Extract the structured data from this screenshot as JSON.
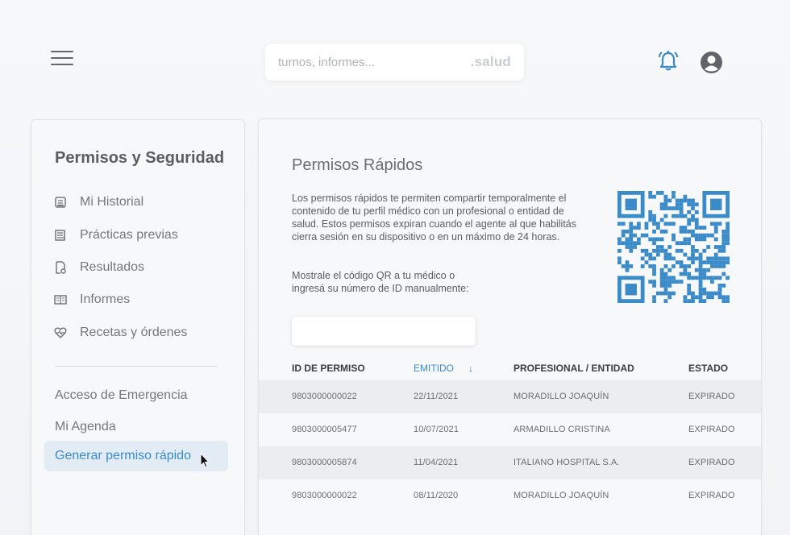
{
  "header": {
    "search_placeholder": "turnos, informes...",
    "brand": ".salud",
    "accent_color": "#3a8bc8",
    "icons": [
      "menu-icon",
      "bell-icon",
      "user-icon"
    ]
  },
  "sidebar": {
    "title": "Permisos y Seguridad",
    "items": [
      {
        "label": "Mi Historial",
        "icon": "history-icon"
      },
      {
        "label": "Prácticas previas",
        "icon": "clipboard-icon"
      },
      {
        "label": "Resultados",
        "icon": "results-icon"
      },
      {
        "label": "Informes",
        "icon": "reports-icon"
      },
      {
        "label": "Recetas y órdenes",
        "icon": "prescription-icon"
      }
    ],
    "links": [
      "Acceso de Emergencia",
      "Mi Agenda"
    ],
    "active": "Generar permiso rápido"
  },
  "main": {
    "title": "Permisos Rápidos",
    "description": "Los permisos rápidos te permiten compartir temporalmente el contenido de tu perfil médico con un profesional o entidad de salud. Estos permisos expiran cuando el agente al que habilitás cierra sesión en su dispositivo o en un máximo de 24 horas.",
    "qr_prompt": "Mostrale el código QR a tu médico o ingresá su número de ID manualmente:",
    "id_input_value": "",
    "table": {
      "columns": [
        "ID DE PERMISO",
        "EMITIDO",
        "PROFESIONAL / ENTIDAD",
        "ESTADO"
      ],
      "sort_arrow": "↓",
      "rows": [
        [
          "9803000000022",
          "22/11/2021",
          "MORADILLO JOAQUÍN",
          "EXPIRADO"
        ],
        [
          "9803000005477",
          "10/07/2021",
          "ARMADILLO CRISTINA",
          "EXPIRADO"
        ],
        [
          "9803000005874",
          "11/04/2021",
          "ITALIANO HOSPITAL S.A.",
          "EXPIRADO"
        ],
        [
          "9803000000022",
          "08/11/2020",
          "MORADILLO JOAQUÍN",
          "EXPIRADO"
        ]
      ]
    }
  }
}
